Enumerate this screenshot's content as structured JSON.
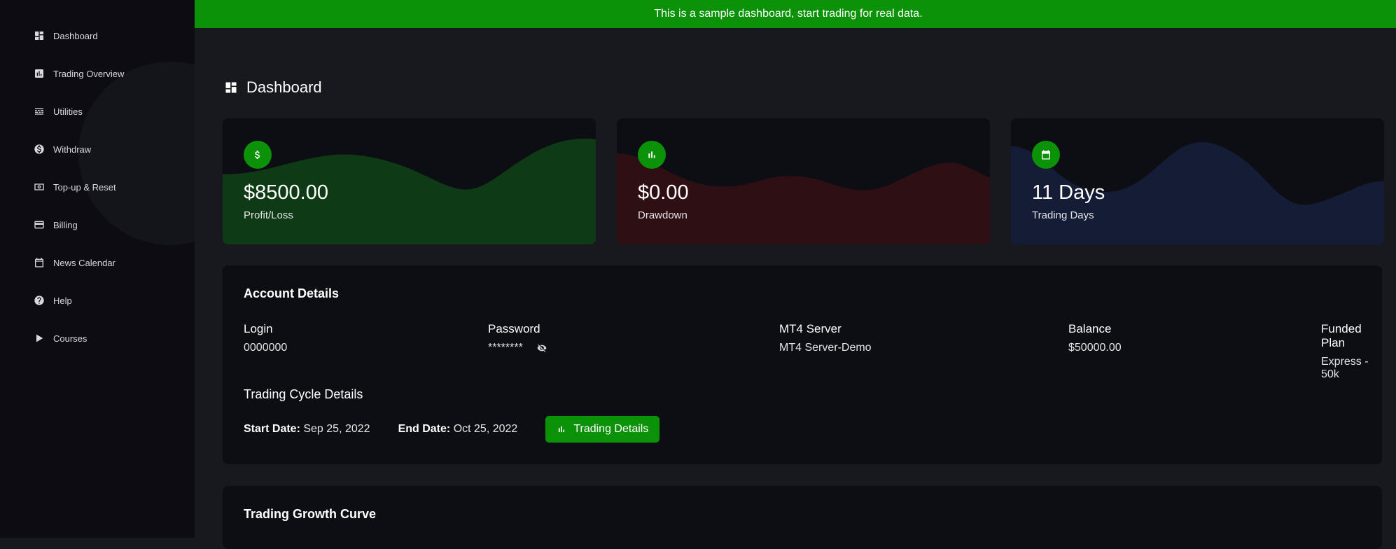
{
  "sidebar": {
    "items": [
      {
        "label": "Dashboard",
        "icon": "dashboard-icon"
      },
      {
        "label": "Trading Overview",
        "icon": "bar-chart-icon"
      },
      {
        "label": "Utilities",
        "icon": "utilities-icon"
      },
      {
        "label": "Withdraw",
        "icon": "dollar-circle-icon"
      },
      {
        "label": "Top-up & Reset",
        "icon": "money-icon"
      },
      {
        "label": "Billing",
        "icon": "credit-card-icon"
      },
      {
        "label": "News Calendar",
        "icon": "calendar-icon"
      },
      {
        "label": "Help",
        "icon": "help-icon"
      },
      {
        "label": "Courses",
        "icon": "play-icon"
      }
    ]
  },
  "banner": {
    "text": "This is a sample dashboard, start trading for real data."
  },
  "page": {
    "title": "Dashboard"
  },
  "cards": [
    {
      "value": "$8500.00",
      "label": "Profit/Loss",
      "icon": "dollar-icon",
      "wave_color": "#0f3a16"
    },
    {
      "value": "$0.00",
      "label": "Drawdown",
      "icon": "bar-chart-icon",
      "wave_color": "#2e0f14"
    },
    {
      "value": "11 Days",
      "label": "Trading Days",
      "icon": "calendar-icon",
      "wave_color": "#141c36"
    }
  ],
  "account": {
    "title": "Account Details",
    "login": {
      "label": "Login",
      "value": "0000000"
    },
    "password": {
      "label": "Password",
      "value": "********"
    },
    "server": {
      "label": "MT4 Server",
      "value": "MT4 Server-Demo"
    },
    "balance": {
      "label": "Balance",
      "value": "$50000.00"
    },
    "plan": {
      "label": "Funded Plan",
      "value": "Express - 50k"
    },
    "cycle": {
      "title": "Trading Cycle Details",
      "start_label": "Start Date:",
      "start_value": "Sep 25, 2022",
      "end_label": "End Date:",
      "end_value": "Oct 25, 2022",
      "button_label": "Trading Details"
    }
  },
  "growth": {
    "title": "Trading Growth Curve"
  },
  "colors": {
    "accent": "#0b9209",
    "sidebar": "#0c0c12",
    "background": "#18181f",
    "card": "#0d0e14"
  }
}
